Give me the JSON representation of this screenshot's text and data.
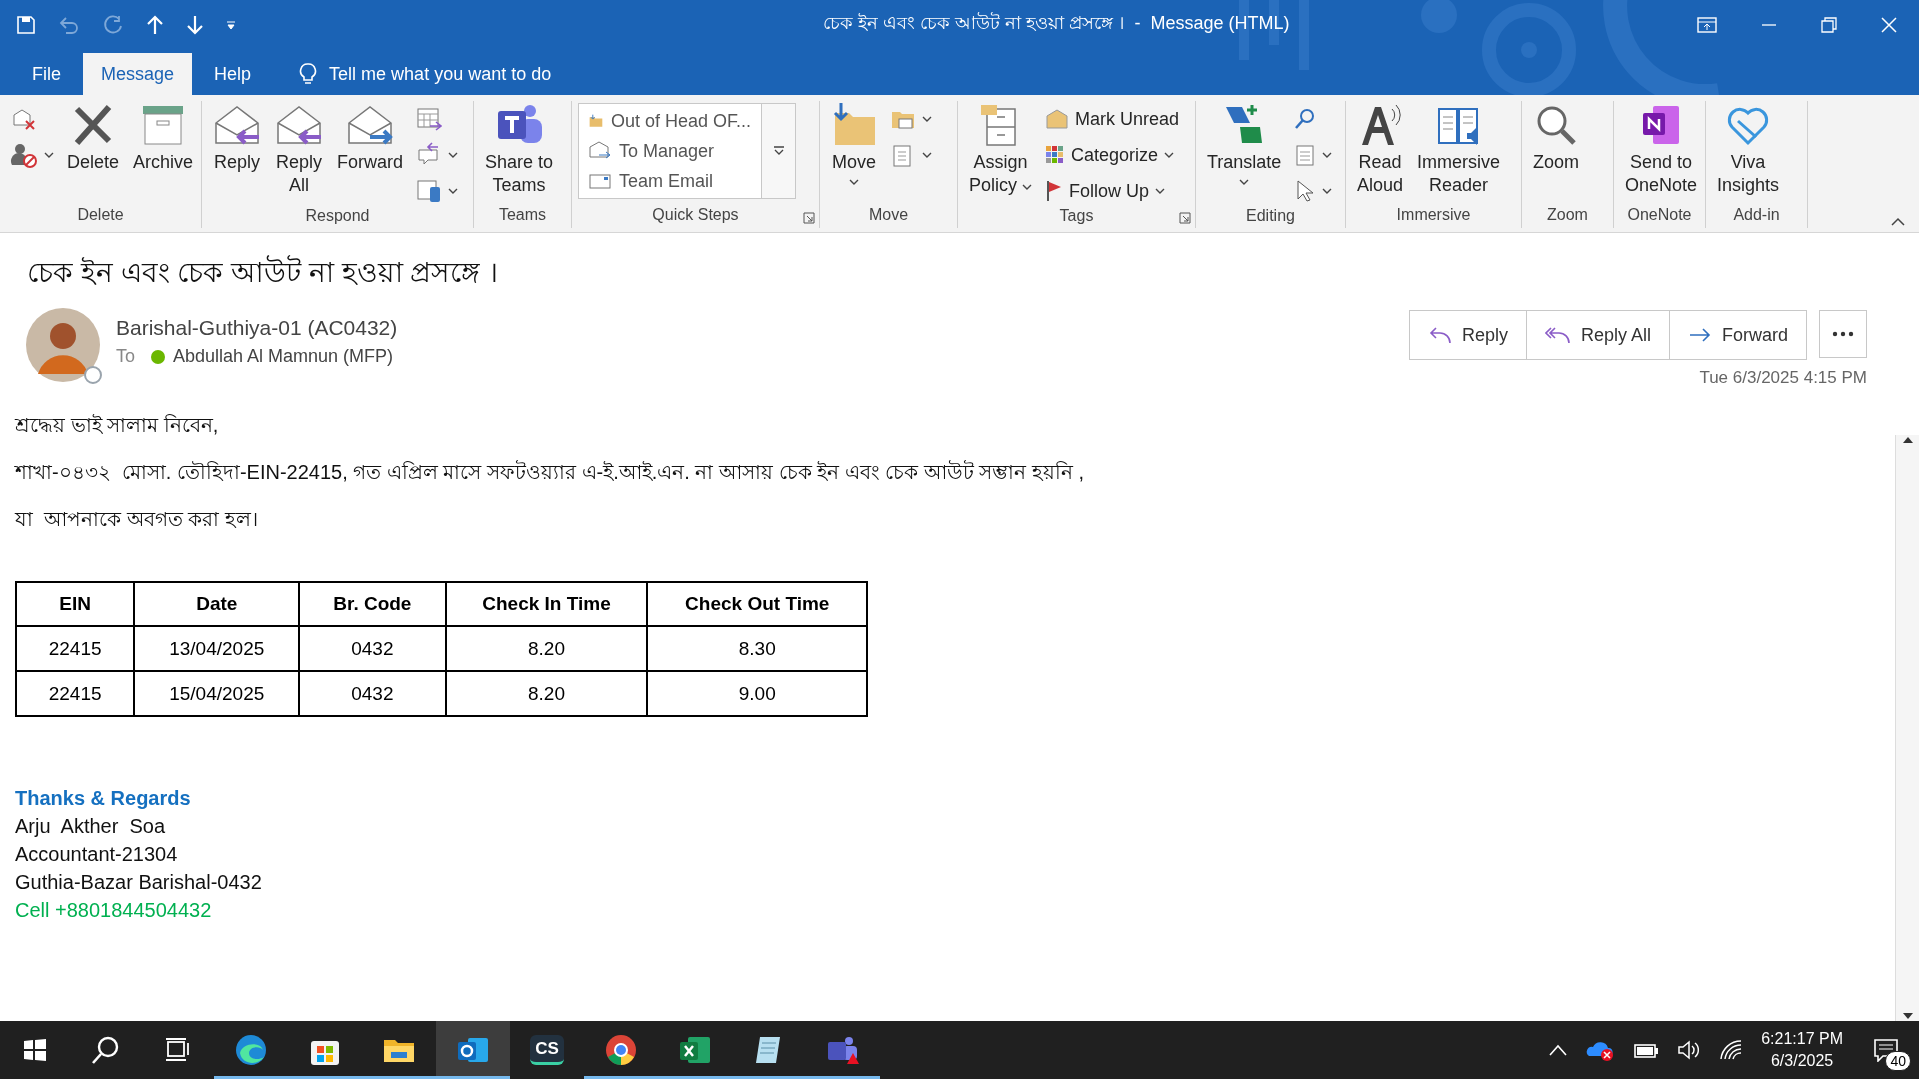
{
  "title_bar": {
    "title": "চেক ইন এবং চেক আউট না হওয়া প্রসঙ্গে ।  -  Message (HTML)"
  },
  "menu_tabs": [
    {
      "label": "File",
      "selected": false
    },
    {
      "label": "Message",
      "selected": true
    },
    {
      "label": "Help",
      "selected": false
    }
  ],
  "tell_me": {
    "placeholder": "Tell me what you want to do"
  },
  "ribbon": {
    "delete": {
      "label": "Delete",
      "buttons": [
        [
          "Delete"
        ],
        [
          "Archive"
        ]
      ]
    },
    "respond": {
      "label": "Respond",
      "buttons": [
        [
          "Reply"
        ],
        [
          "Reply",
          "All"
        ],
        [
          "Forward"
        ]
      ]
    },
    "teams": {
      "label": "Teams",
      "buttons": [
        [
          "Share to",
          "Teams"
        ]
      ]
    },
    "quick_steps": {
      "label": "Quick Steps",
      "steps": [
        "Out of Head OF...",
        "To Manager",
        "Team Email"
      ]
    },
    "move": {
      "label": "Move",
      "buttons": [
        [
          "Move"
        ]
      ]
    },
    "tags": {
      "label": "Tags",
      "buttons": [
        [
          "Assign",
          "Policy"
        ]
      ],
      "small": [
        "Mark Unread",
        "Categorize",
        "Follow Up"
      ]
    },
    "editing": {
      "label": "Editing",
      "buttons": [
        [
          "Translate"
        ]
      ]
    },
    "immersive": {
      "label": "Immersive",
      "buttons": [
        [
          "Read",
          "Aloud"
        ],
        [
          "Immersive",
          "Reader"
        ]
      ]
    },
    "zoom": {
      "label": "Zoom",
      "buttons": [
        [
          "Zoom"
        ]
      ]
    },
    "onenote": {
      "label": "OneNote",
      "buttons": [
        [
          "Send to",
          "OneNote"
        ]
      ]
    },
    "addin": {
      "label": "Add-in",
      "buttons": [
        [
          "Viva",
          "Insights"
        ]
      ]
    }
  },
  "message": {
    "subject": "চেক ইন এবং চেক আউট না হওয়া প্রসঙ্গে ।",
    "sender": {
      "name": "Barishal-Guthiya-01 (AC0432)",
      "available": false
    },
    "to_label": "To",
    "recipient": {
      "name": "Abdullah Al Mamnun (MFP)",
      "available": true
    },
    "actions": [
      "Reply",
      "Reply All",
      "Forward"
    ],
    "date": "Tue 6/3/2025 4:15 PM",
    "body": [
      "শ্রদ্ধেয় ভাই সালাম নিবেন,",
      "শাখা-০৪৩২  মোসা. তৌহিদা-EIN-22415, গত এপ্রিল মাসে সফটওয়্যার এ-ই.আই.এন. না আসায় চেক ইন এবং চেক আউট সম্ভান হয়নি ,",
      "যা  আপনাকে অবগত করা হল।"
    ],
    "table": {
      "columns": [
        "EIN",
        "Date",
        "Br. Code",
        "Check In Time",
        "Check Out Time"
      ],
      "rows": [
        [
          "22415",
          "13/04/2025",
          "0432",
          "8.20",
          "8.30"
        ],
        [
          "22415",
          "15/04/2025",
          "0432",
          "8.20",
          "9.00"
        ]
      ]
    },
    "signature": [
      {
        "kind": "heading",
        "text": "Thanks & Regards"
      },
      {
        "kind": "text",
        "text": "Arju  Akther  Soa"
      },
      {
        "kind": "text",
        "text": "Accountant-21304"
      },
      {
        "kind": "text",
        "text": "Guthia-Bazar Barishal-0432"
      },
      {
        "kind": "phone",
        "text": "Cell +8801844504432"
      }
    ]
  },
  "taskbar": {
    "apps": [
      {
        "kind": "edge",
        "running": true,
        "selected": false
      },
      {
        "kind": "store",
        "running": true,
        "selected": false
      },
      {
        "kind": "explorer",
        "running": true,
        "selected": false
      },
      {
        "kind": "outlook",
        "running": true,
        "selected": true
      },
      {
        "kind": "cs",
        "label": "CS",
        "running": false,
        "selected": false
      },
      {
        "kind": "chrome",
        "running": true,
        "selected": false
      },
      {
        "kind": "excel",
        "running": true,
        "selected": false
      },
      {
        "kind": "notepad",
        "running": true,
        "selected": false
      },
      {
        "kind": "teams",
        "running": true,
        "selected": false
      }
    ],
    "time": "6:21:17 PM",
    "date": "6/3/2025",
    "notifications": "40"
  }
}
